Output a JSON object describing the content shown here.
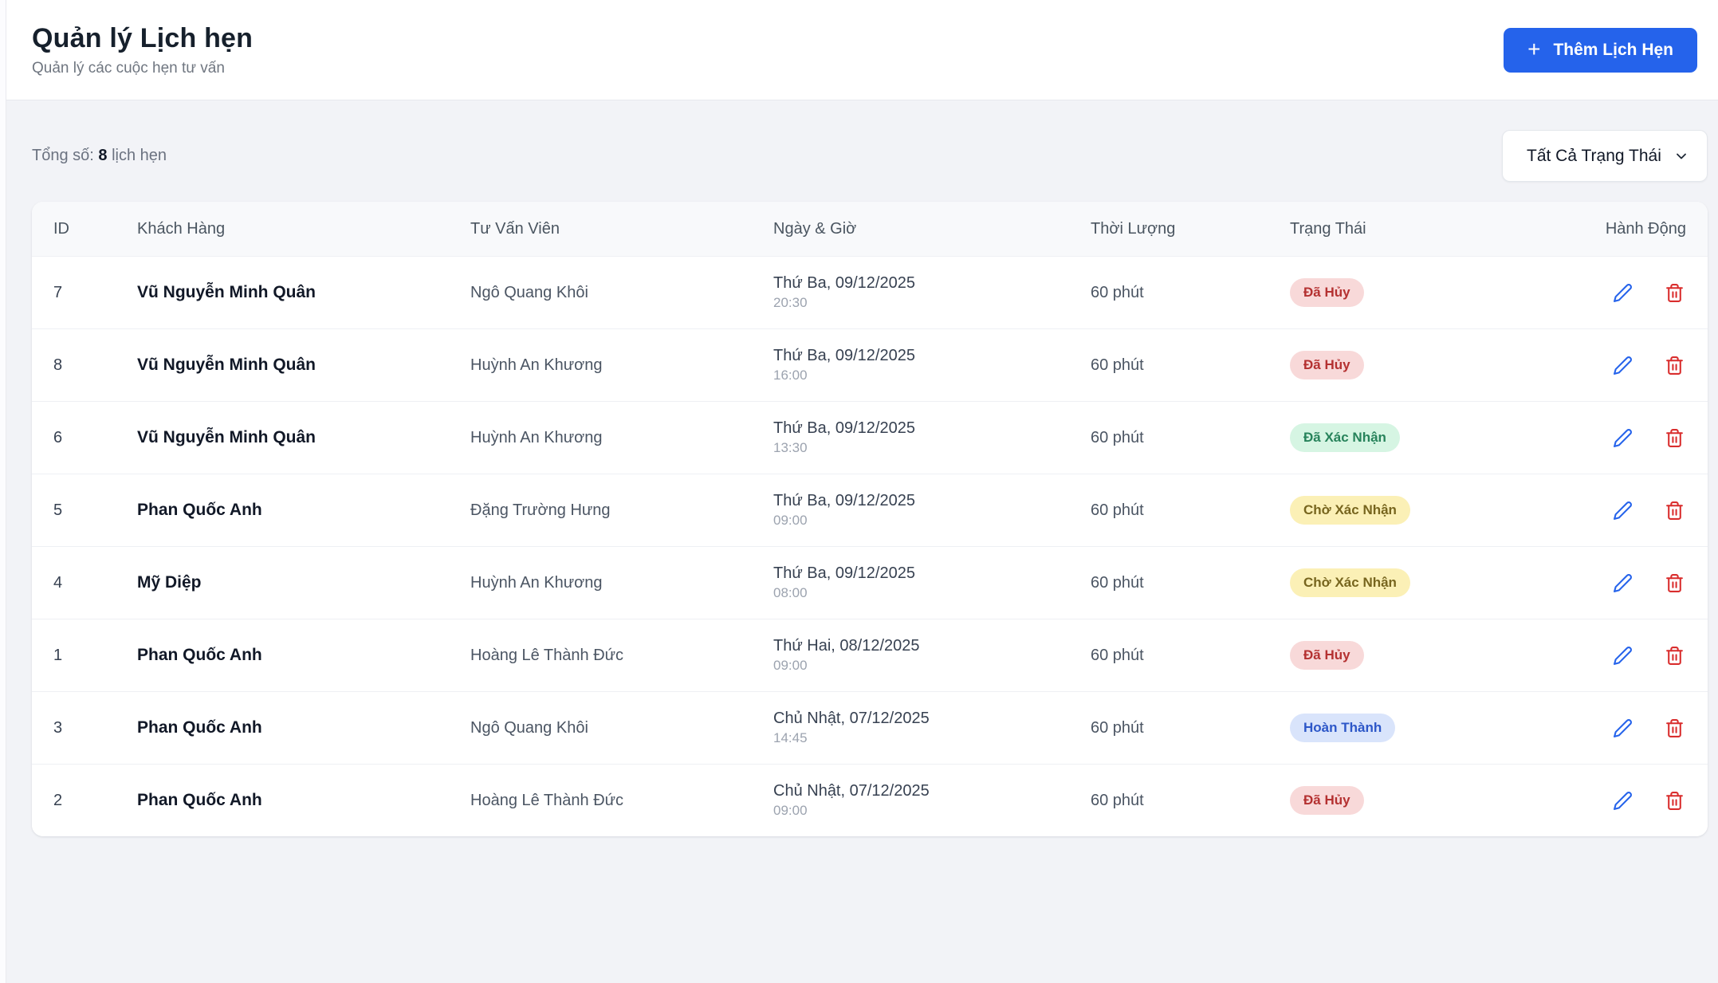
{
  "page": {
    "title": "Quản lý Lịch hẹn",
    "subtitle": "Quản lý các cuộc hẹn tư vấn"
  },
  "toolbar": {
    "add_button_icon": "+",
    "add_button_label": "Thêm Lịch Hẹn",
    "total_prefix": "Tổng số:",
    "total_count": "8",
    "total_suffix": "lịch hẹn",
    "status_filter_value": "Tất Cả Trạng Thái"
  },
  "colors": {
    "accent": "#2563eb",
    "edit_icon": "#2563eb",
    "delete_icon": "#d92d2d"
  },
  "statuses": {
    "cancelled": {
      "label": "Đã Hủy",
      "bg": "#f8d9d9",
      "fg": "#b43131"
    },
    "confirmed": {
      "label": "Đã Xác Nhận",
      "bg": "#d6f5e3",
      "fg": "#27835b"
    },
    "pending": {
      "label": "Chờ Xác Nhận",
      "bg": "#fbf0b6",
      "fg": "#77651e"
    },
    "completed": {
      "label": "Hoàn Thành",
      "bg": "#d9e4fb",
      "fg": "#2d57c8"
    }
  },
  "table": {
    "headers": [
      "ID",
      "Khách Hàng",
      "Tư Vấn Viên",
      "Ngày & Giờ",
      "Thời Lượng",
      "Trạng Thái",
      "Hành Động"
    ],
    "rows": [
      {
        "id": "7",
        "customer": "Vũ Nguyễn Minh Quân",
        "consultant": "Ngô Quang Khôi",
        "date": "Thứ Ba, 09/12/2025",
        "time": "20:30",
        "duration": "60 phút",
        "status": "cancelled"
      },
      {
        "id": "8",
        "customer": "Vũ Nguyễn Minh Quân",
        "consultant": "Huỳnh An Khương",
        "date": "Thứ Ba, 09/12/2025",
        "time": "16:00",
        "duration": "60 phút",
        "status": "cancelled"
      },
      {
        "id": "6",
        "customer": "Vũ Nguyễn Minh Quân",
        "consultant": "Huỳnh An Khương",
        "date": "Thứ Ba, 09/12/2025",
        "time": "13:30",
        "duration": "60 phút",
        "status": "confirmed"
      },
      {
        "id": "5",
        "customer": "Phan Quốc Anh",
        "consultant": "Đặng Trường Hưng",
        "date": "Thứ Ba, 09/12/2025",
        "time": "09:00",
        "duration": "60 phút",
        "status": "pending"
      },
      {
        "id": "4",
        "customer": "Mỹ Diệp",
        "consultant": "Huỳnh An Khương",
        "date": "Thứ Ba, 09/12/2025",
        "time": "08:00",
        "duration": "60 phút",
        "status": "pending"
      },
      {
        "id": "1",
        "customer": "Phan Quốc Anh",
        "consultant": "Hoàng Lê Thành Đức",
        "date": "Thứ Hai, 08/12/2025",
        "time": "09:00",
        "duration": "60 phút",
        "status": "cancelled"
      },
      {
        "id": "3",
        "customer": "Phan Quốc Anh",
        "consultant": "Ngô Quang Khôi",
        "date": "Chủ Nhật, 07/12/2025",
        "time": "14:45",
        "duration": "60 phút",
        "status": "completed"
      },
      {
        "id": "2",
        "customer": "Phan Quốc Anh",
        "consultant": "Hoàng Lê Thành Đức",
        "date": "Chủ Nhật, 07/12/2025",
        "time": "09:00",
        "duration": "60 phút",
        "status": "cancelled"
      }
    ]
  }
}
